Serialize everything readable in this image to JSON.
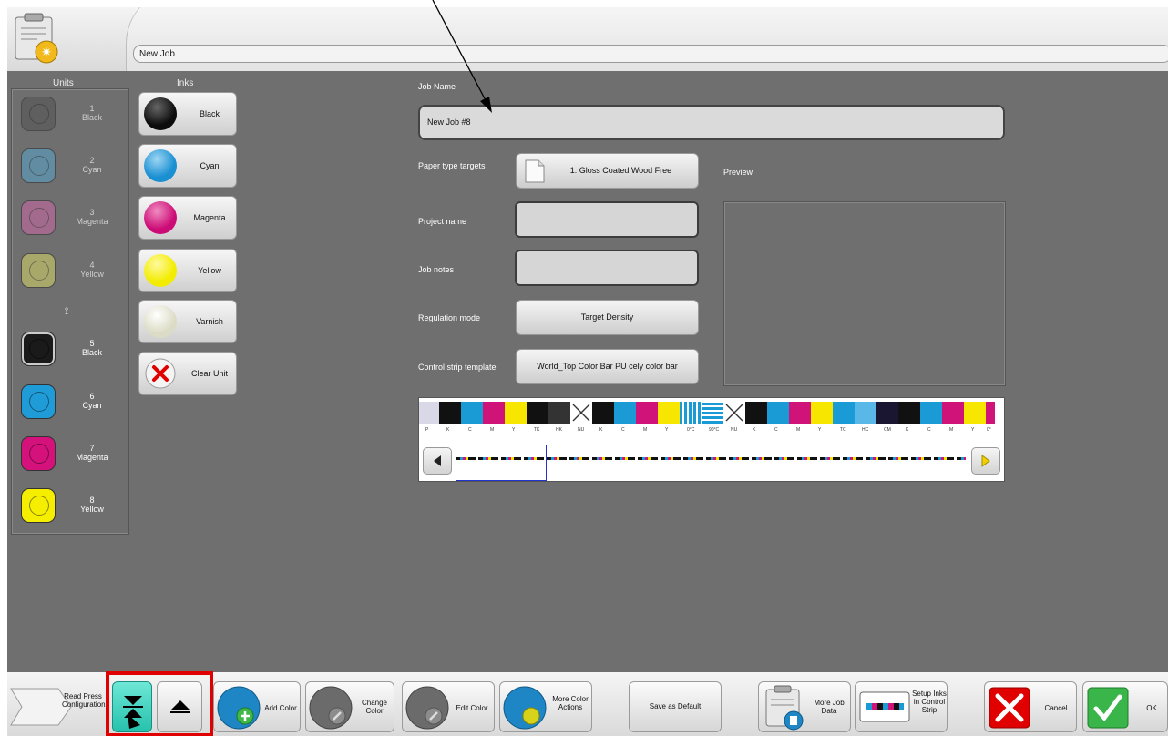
{
  "header": {
    "title_value": "New Job"
  },
  "columns": {
    "units": "Units",
    "inks": "Inks"
  },
  "units": [
    {
      "number": "1",
      "label": "Black",
      "color": "#555555",
      "dim": true
    },
    {
      "number": "2",
      "label": "Cyan",
      "color": "#5aa0c4",
      "dim": true
    },
    {
      "number": "3",
      "label": "Magenta",
      "color": "#c46aa3",
      "dim": true
    },
    {
      "number": "4",
      "label": "Yellow",
      "color": "#cfcf6a",
      "dim": true
    },
    {
      "number": "5",
      "label": "Black",
      "color": "#1a1a1a",
      "dim": false
    },
    {
      "number": "6",
      "label": "Cyan",
      "color": "#1f9cd8",
      "dim": false
    },
    {
      "number": "7",
      "label": "Magenta",
      "color": "#d5127c",
      "dim": false
    },
    {
      "number": "8",
      "label": "Yellow",
      "color": "#f5ee00",
      "dim": false
    }
  ],
  "inks": [
    {
      "label": "Black",
      "color": "#0d0d0d"
    },
    {
      "label": "Cyan",
      "color": "#1a8fd2"
    },
    {
      "label": "Magenta",
      "color": "#cc0c76"
    },
    {
      "label": "Yellow",
      "color": "#f2ec00"
    },
    {
      "label": "Varnish",
      "color": "#e9ead8"
    },
    {
      "label": "Clear Unit",
      "color": "#e00000"
    }
  ],
  "form": {
    "job_name_label": "Job Name",
    "job_name_value": "New Job #8",
    "paper_type_label": "Paper type targets",
    "paper_type_value": "1: Gloss Coated Wood Free",
    "preview_label": "Preview",
    "project_name_label": "Project name",
    "project_name_value": "",
    "job_notes_label": "Job notes",
    "job_notes_value": "",
    "regulation_mode_label": "Regulation mode",
    "regulation_mode_value": "Target Density",
    "control_strip_label": "Control strip template",
    "control_strip_value": "World_Top Color Bar PU cely color bar"
  },
  "strip": {
    "patch_labels": [
      "P",
      "K",
      "C",
      "M",
      "Y",
      "TK",
      "HK",
      "NU",
      "K",
      "C",
      "M",
      "Y",
      "0°C",
      "90°C",
      "NU",
      "K",
      "C",
      "M",
      "Y",
      "TC",
      "HC",
      "CM",
      "K",
      "C",
      "M",
      "Y",
      "0°"
    ]
  },
  "bottom": {
    "read_press": "Read Press Configuration",
    "add_color": "Add Color",
    "change_color": "Change Color",
    "edit_color": "Edit Color",
    "more_color_actions": "More Color Actions",
    "save_default": "Save as Default",
    "more_job_data": "More Job Data",
    "setup_inks": "Setup Inks in Control Strip",
    "cancel": "Cancel",
    "ok": "OK"
  }
}
